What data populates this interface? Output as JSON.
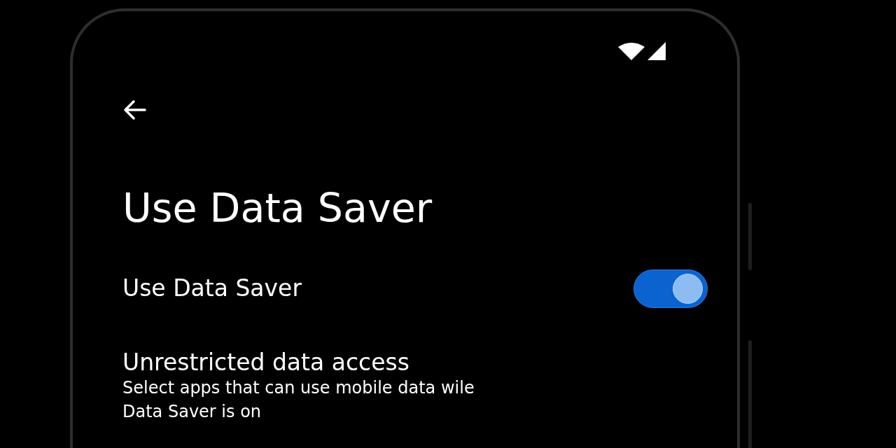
{
  "header": {
    "title": "Use Data Saver"
  },
  "settings": [
    {
      "kind": "switch",
      "label": "Use Data Saver",
      "on": true
    },
    {
      "kind": "link",
      "label": "Unrestricted data access",
      "summary": "Select apps that can use mobile data wile\nData Saver is on"
    }
  ]
}
